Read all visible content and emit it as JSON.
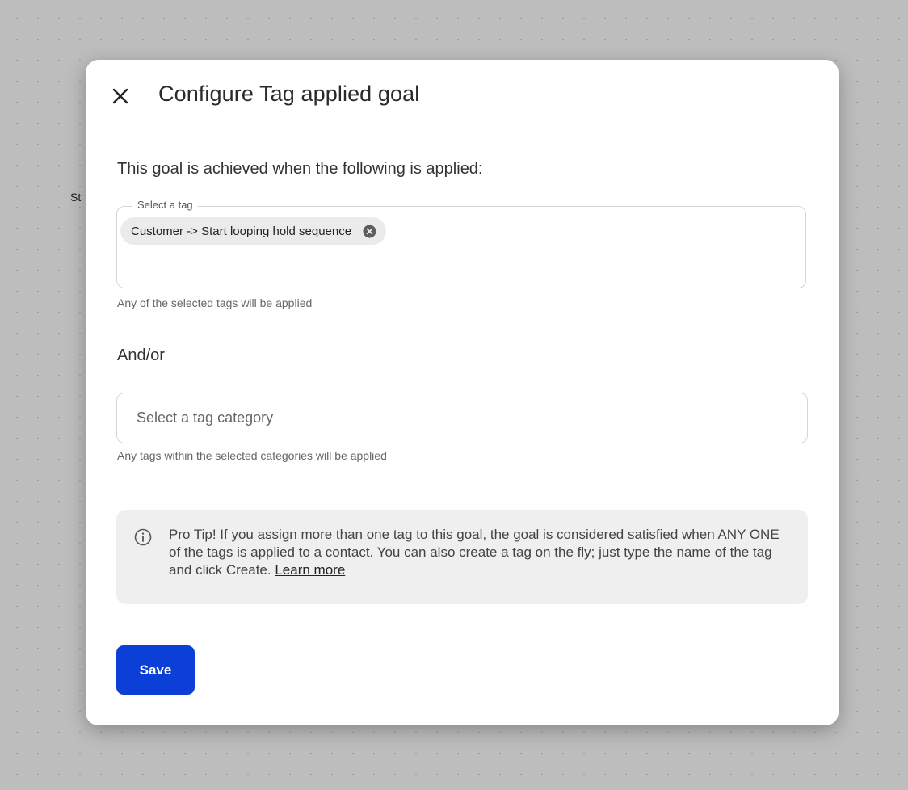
{
  "background": {
    "node_label": "St"
  },
  "modal": {
    "title": "Configure Tag applied goal",
    "close_icon": "close-icon",
    "intro": "This goal is achieved when the following is applied:",
    "tag_select": {
      "label": "Select a tag",
      "selected_tags": [
        "Customer -> Start looping hold sequence"
      ],
      "helper": "Any of the selected tags will be applied"
    },
    "andor_label": "And/or",
    "category_select": {
      "placeholder": "Select a tag category",
      "value": "",
      "helper": "Any tags within the selected categories will be applied"
    },
    "tip": {
      "icon": "info-icon",
      "text": "Pro Tip! If you assign more than one tag to this goal, the goal is considered satisfied when ANY ONE of the tags is applied to a contact. You can also create a tag on the fly; just type the name of the tag and click Create. ",
      "link_label": "Learn more"
    },
    "save_label": "Save"
  },
  "colors": {
    "primary": "#0b3fd8",
    "backdrop": "#bdbdbd",
    "chip_bg": "#ebebeb",
    "tip_bg": "#efefef"
  }
}
